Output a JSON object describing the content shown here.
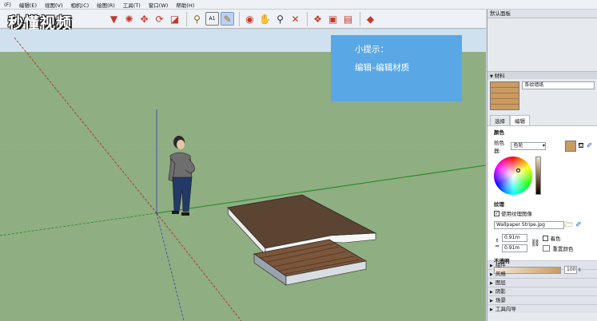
{
  "logo": {
    "text": "秒懂视频"
  },
  "menu": [
    "(F)",
    "编辑(E)",
    "视图(V)",
    "相机(C)",
    "绘图(R)",
    "工具(T)",
    "窗口(W)",
    "帮助(H)"
  ],
  "toolbar": {
    "icons": [
      "paint-bucket-icon",
      "rotate-icon",
      "move-icon",
      "redo-icon",
      "scale-icon",
      "tape-measure-icon",
      "text-icon",
      "paint-icon",
      "orbit-icon",
      "pan-icon",
      "zoom-icon",
      "zoom-extents-icon",
      "component-icon",
      "box-icon",
      "warehouse-icon"
    ],
    "text_tool_label": "A1"
  },
  "tip": {
    "line1": "小提示：",
    "line2": "编辑–编辑材质"
  },
  "panel": {
    "title": "默认面板",
    "materials_label": "材料",
    "material_name": "条纹墙纸",
    "tabs": [
      "选择",
      "编辑"
    ],
    "color_section": "颜色",
    "picker_label": "拾色器:",
    "picker_value": "色轮",
    "texture_section": "纹理",
    "use_texture_label": "使用纹理图像",
    "texture_file": "Wallpaper Stripe.jpg",
    "width_value": "0.91m",
    "height_value": "0.91m",
    "colorize_label": "着色",
    "reset_color_label": "重置颜色",
    "opacity_section": "不透明",
    "opacity_value": "100",
    "folded_sections": [
      "组件",
      "风格",
      "图层",
      "阴影",
      "场景",
      "工具向导"
    ],
    "swatch_color": "#c99b63"
  }
}
